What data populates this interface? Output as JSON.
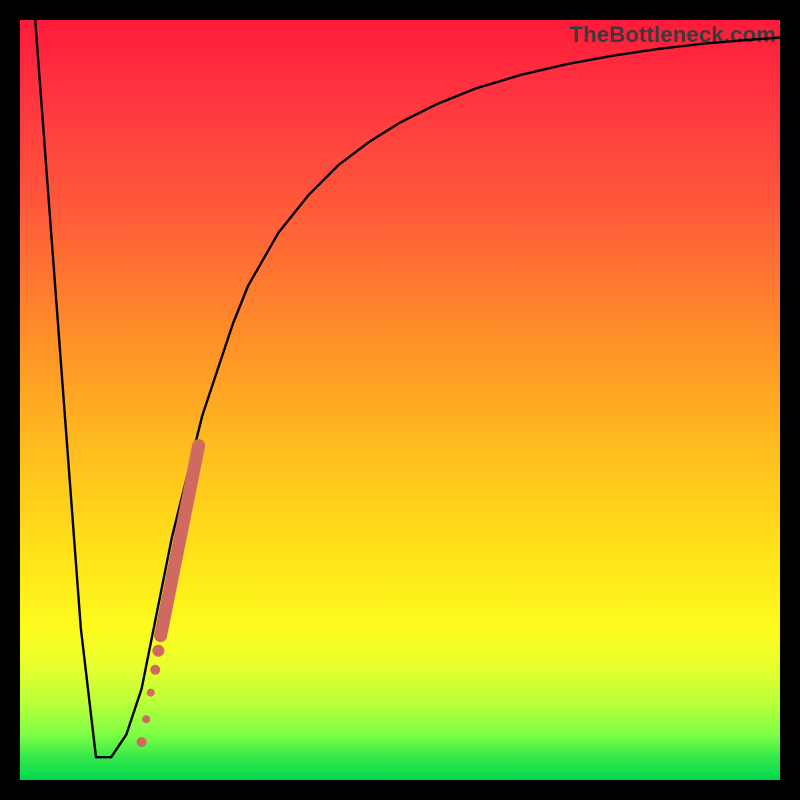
{
  "watermark": "TheBottleneck.com",
  "chart_data": {
    "type": "line",
    "title": "",
    "xlabel": "",
    "ylabel": "",
    "xlim": [
      0,
      100
    ],
    "ylim": [
      0,
      100
    ],
    "gradient_meaning": "red=high bottleneck, green=low bottleneck",
    "series": [
      {
        "name": "bottleneck-curve",
        "x": [
          2,
          5,
          8,
          10,
          12,
          14,
          16,
          18,
          20,
          22,
          24,
          26,
          28,
          30,
          34,
          38,
          42,
          46,
          50,
          55,
          60,
          66,
          72,
          78,
          84,
          90,
          96,
          100
        ],
        "y": [
          100,
          60,
          20,
          3,
          3,
          6,
          12,
          22,
          32,
          40,
          48,
          54,
          60,
          65,
          72,
          77,
          81,
          84,
          86.5,
          89,
          91,
          92.8,
          94.2,
          95.3,
          96.2,
          96.9,
          97.4,
          97.7
        ]
      }
    ],
    "highlight_points": {
      "name": "marked-segment",
      "color": "#d06a60",
      "points": [
        {
          "x": 16.0,
          "y": 5.0,
          "r": 5
        },
        {
          "x": 16.6,
          "y": 8.0,
          "r": 4
        },
        {
          "x": 17.2,
          "y": 11.5,
          "r": 4
        },
        {
          "x": 17.8,
          "y": 14.5,
          "r": 5
        },
        {
          "x": 18.2,
          "y": 17.0,
          "r": 6
        }
      ],
      "thick_segment": {
        "x1": 18.5,
        "y1": 19.0,
        "x2": 23.5,
        "y2": 44.0
      }
    }
  }
}
